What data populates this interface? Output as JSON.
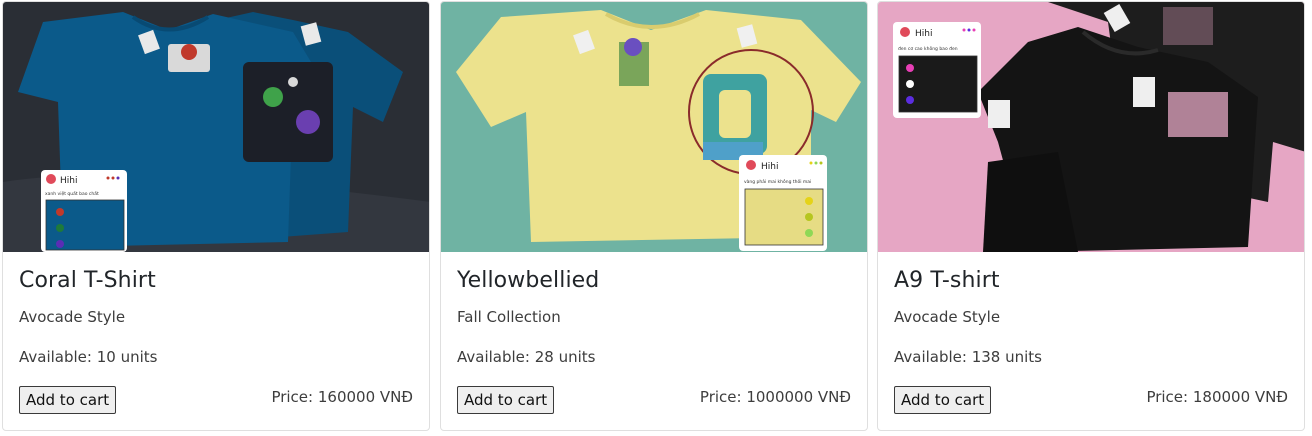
{
  "products": [
    {
      "title": "Coral T-Shirt",
      "collection": "Avocade Style",
      "availability": "Available: 10 units",
      "button_label": "Add to cart",
      "price": "Price: 160000 VNĐ",
      "photo": {
        "tag_brand": "Hihi",
        "tag_caption": "xanh việt quất bao chất",
        "swatch_colors": [
          "#c0392b",
          "#1e7a3a",
          "#5b2db5"
        ],
        "background_color": "#2a2e35",
        "shirt_color": "#0b5a8a"
      }
    },
    {
      "title": "Yellowbellied",
      "collection": "Fall Collection",
      "availability": "Available: 28 units",
      "button_label": "Add to cart",
      "price": "Price: 1000000 VNĐ",
      "photo": {
        "tag_brand": "Hihi",
        "tag_caption": "vàng phải mai không thối mai",
        "swatch_colors": [
          "#e5d318",
          "#b6c61f",
          "#8fd856"
        ],
        "background_color": "#6fb3a3",
        "shirt_color": "#ece28d"
      }
    },
    {
      "title": "A9 T-shirt",
      "collection": "Avocade Style",
      "availability": "Available: 138 units",
      "button_label": "Add to cart",
      "price": "Price: 180000 VNĐ",
      "photo": {
        "tag_brand": "Hihi",
        "tag_caption": "đen cơ cao không bao đen",
        "swatch_colors": [
          "#e83fb6",
          "#ffffff",
          "#5b2de0"
        ],
        "background_color": "#e6a6c4",
        "shirt_color": "#141414"
      }
    }
  ]
}
